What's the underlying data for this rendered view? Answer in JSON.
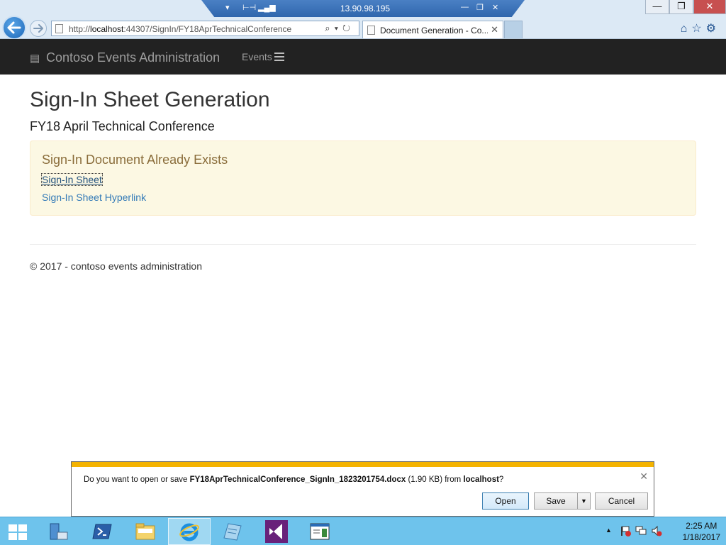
{
  "rdp": {
    "host": "13.90.98.195"
  },
  "browser": {
    "url_prefix": "http://",
    "url_host": "localhost",
    "url_rest": ":44307/SignIn/FY18AprTechnicalConference",
    "tab_title": "Document Generation - Co...",
    "window_buttons": {
      "minimize": "—",
      "restore": "❐",
      "close": "✕"
    }
  },
  "navbar": {
    "brand": "Contoso Events Administration",
    "events_link": "Events"
  },
  "page": {
    "title": "Sign-In Sheet Generation",
    "subtitle": "FY18 April Technical Conference",
    "alert": {
      "heading": "Sign-In Document Already Exists",
      "link_sheet": "Sign-In Sheet",
      "link_hyperlink": "Sign-In Sheet Hyperlink"
    },
    "footer": "© 2017 - contoso events administration"
  },
  "download_bar": {
    "prompt_prefix": "Do you want to open or save ",
    "file_name": "FY18AprTechnicalConference_SignIn_1823201754.docx",
    "size": " (1.90 KB) from ",
    "source": "localhost",
    "prompt_suffix": "?",
    "open_label": "Open",
    "save_label": "Save",
    "cancel_label": "Cancel"
  },
  "taskbar": {
    "items": [
      "start",
      "server-manager",
      "powershell",
      "file-explorer",
      "internet-explorer",
      "notepad",
      "visual-studio",
      "presentation"
    ],
    "time": "2:25 AM",
    "date": "1/18/2017"
  },
  "colors": {
    "navbar_bg": "#222222",
    "alert_bg": "#fcf8e3",
    "alert_text": "#8a6d3b",
    "link": "#337ab7",
    "download_stripe": "#f4b300",
    "taskbar_bg": "#6ec3ec"
  }
}
